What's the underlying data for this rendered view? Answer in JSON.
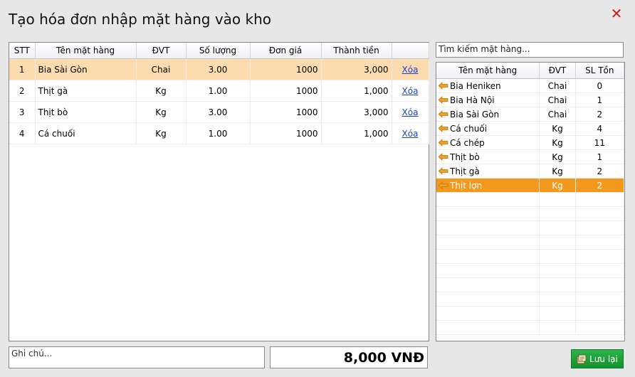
{
  "window": {
    "title": "Tạo hóa đơn nhập mặt hàng vào kho",
    "close_icon": "close-icon",
    "accent": "#d01818"
  },
  "invoice": {
    "columns": [
      "STT",
      "Tên mặt hàng",
      "ĐVT",
      "Số lượng",
      "Đơn giá",
      "Thành tiền",
      ""
    ],
    "rows": [
      {
        "stt": "1",
        "name": "Bia Sài Gòn",
        "unit": "Chai",
        "qty": "3.00",
        "price": "1000",
        "amount": "3,000",
        "action": "Xóa"
      },
      {
        "stt": "2",
        "name": "Thịt gà",
        "unit": "Kg",
        "qty": "1.00",
        "price": "1000",
        "amount": "1,000",
        "action": "Xóa"
      },
      {
        "stt": "3",
        "name": "Thịt bò",
        "unit": "Kg",
        "qty": "3.00",
        "price": "1000",
        "amount": "3,000",
        "action": "Xóa"
      },
      {
        "stt": "4",
        "name": "Cá chuối",
        "unit": "Kg",
        "qty": "1.00",
        "price": "1000",
        "amount": "1,000",
        "action": "Xóa"
      }
    ],
    "selected_row_color": "#fcdcae"
  },
  "search": {
    "placeholder": "Tìm kiếm mặt hàng..."
  },
  "stock": {
    "columns": [
      "Tên mặt hàng",
      "ĐVT",
      "SL Tồn"
    ],
    "rows": [
      {
        "name": "Bia Heniken",
        "unit": "Chai",
        "qty": "0"
      },
      {
        "name": "Bia Hà Nội",
        "unit": "Chai",
        "qty": "1"
      },
      {
        "name": "Bia Sài Gòn",
        "unit": "Chai",
        "qty": "2"
      },
      {
        "name": "Cá chuối",
        "unit": "Kg",
        "qty": "4"
      },
      {
        "name": "Cá chép",
        "unit": "Kg",
        "qty": "11"
      },
      {
        "name": "Thịt bò",
        "unit": "Kg",
        "qty": "1"
      },
      {
        "name": "Thịt gà",
        "unit": "Kg",
        "qty": "2"
      },
      {
        "name": "Thịt lợn",
        "unit": "Kg",
        "qty": "2"
      }
    ],
    "selected_index": 7,
    "selected_row_color": "#f39a1e",
    "row_icon": "left-arrow-icon"
  },
  "note": {
    "placeholder": "Ghi chú..."
  },
  "total": {
    "value": "8,000 VNĐ"
  },
  "save_button": {
    "label": "Lưu lại",
    "icon": "save-icon",
    "color": "#1fa33d"
  }
}
